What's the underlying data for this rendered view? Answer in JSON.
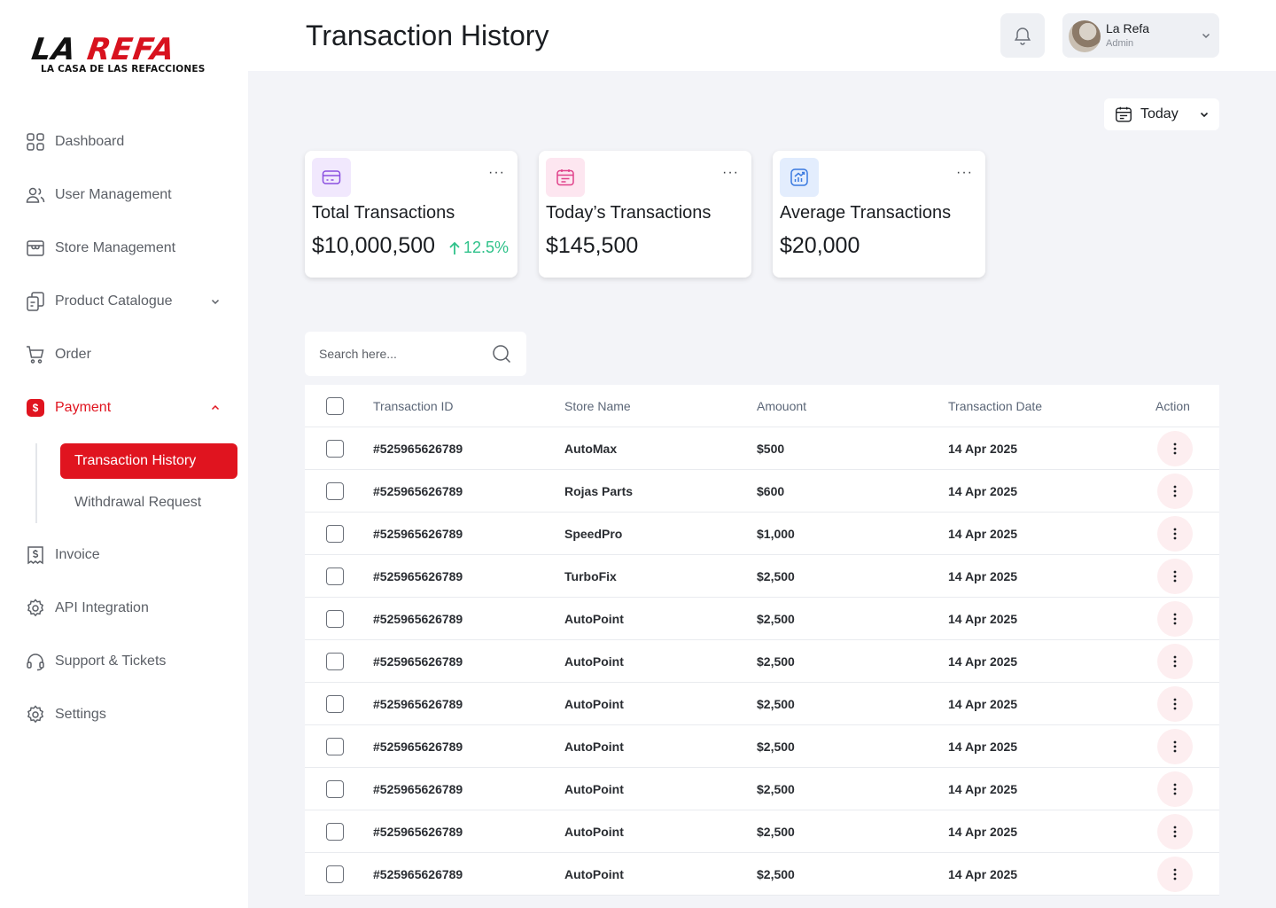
{
  "brand": {
    "logo_main_a": "LA ",
    "logo_main_b": "REFA",
    "logo_sub": "LA CASA DE LAS REFACCIONES",
    "accent": "#e0141f"
  },
  "sidebar": {
    "items": [
      {
        "label": "Dashboard",
        "icon": "grid-icon"
      },
      {
        "label": "User Management",
        "icon": "users-icon"
      },
      {
        "label": "Store Management",
        "icon": "store-icon"
      },
      {
        "label": "Product Catalogue",
        "icon": "catalogue-icon"
      },
      {
        "label": "Order",
        "icon": "cart-icon"
      },
      {
        "label": "Payment",
        "icon": "dollar-icon",
        "badge": "$"
      },
      {
        "label": "Invoice",
        "icon": "invoice-icon"
      },
      {
        "label": "API Integration",
        "icon": "api-gear-icon"
      },
      {
        "label": "Support & Tickets",
        "icon": "headset-icon"
      },
      {
        "label": "Settings",
        "icon": "gear-icon"
      }
    ],
    "payment_sub": [
      {
        "label": "Transaction History",
        "active": true
      },
      {
        "label": "Withdrawal Request",
        "active": false
      }
    ]
  },
  "header": {
    "title": "Transaction History",
    "user": {
      "name": "La Refa",
      "role": "Admin"
    }
  },
  "filter": {
    "date_label": "Today"
  },
  "cards": [
    {
      "title": "Total Transactions",
      "value": "$10,000,500",
      "delta": "12.5%",
      "icon": "card-icon",
      "icon_bg": "#f1e8fd",
      "icon_color": "#8a4fe0"
    },
    {
      "title": "Today’s Transactions",
      "value": "$145,500",
      "icon": "calendar-icon",
      "icon_bg": "#fde6f0",
      "icon_color": "#e0418a"
    },
    {
      "title": "Average Transactions",
      "value": "$20,000",
      "icon": "chart-icon",
      "icon_bg": "#e3edfd",
      "icon_color": "#3a7ae0"
    }
  ],
  "search": {
    "placeholder": "Search here..."
  },
  "table": {
    "columns": [
      "Transaction ID",
      "Store Name",
      "Amouont",
      "Transaction Date",
      "Action"
    ],
    "rows": [
      {
        "id": "#525965626789",
        "store": "AutoMax",
        "amount": "$500",
        "date": "14 Apr 2025"
      },
      {
        "id": "#525965626789",
        "store": "Rojas Parts",
        "amount": "$600",
        "date": "14 Apr 2025"
      },
      {
        "id": "#525965626789",
        "store": "SpeedPro",
        "amount": "$1,000",
        "date": "14 Apr 2025"
      },
      {
        "id": "#525965626789",
        "store": "TurboFix",
        "amount": "$2,500",
        "date": "14 Apr 2025"
      },
      {
        "id": "#525965626789",
        "store": "AutoPoint",
        "amount": "$2,500",
        "date": "14 Apr 2025"
      },
      {
        "id": "#525965626789",
        "store": "AutoPoint",
        "amount": "$2,500",
        "date": "14 Apr 2025"
      },
      {
        "id": "#525965626789",
        "store": "AutoPoint",
        "amount": "$2,500",
        "date": "14 Apr 2025"
      },
      {
        "id": "#525965626789",
        "store": "AutoPoint",
        "amount": "$2,500",
        "date": "14 Apr 2025"
      },
      {
        "id": "#525965626789",
        "store": "AutoPoint",
        "amount": "$2,500",
        "date": "14 Apr 2025"
      },
      {
        "id": "#525965626789",
        "store": "AutoPoint",
        "amount": "$2,500",
        "date": "14 Apr 2025"
      },
      {
        "id": "#525965626789",
        "store": "AutoPoint",
        "amount": "$2,500",
        "date": "14 Apr 2025"
      }
    ]
  }
}
